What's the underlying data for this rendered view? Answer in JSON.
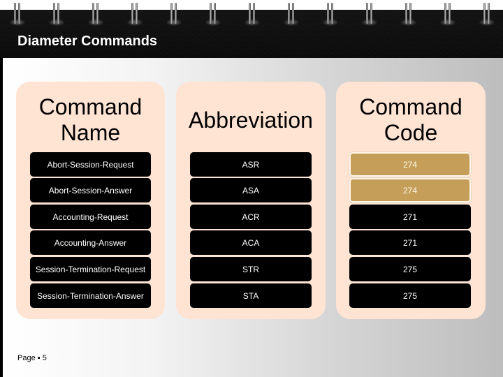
{
  "slide": {
    "title": "Diameter Commands",
    "footer": "Page ▪ 5"
  },
  "table": {
    "headers": {
      "name": "Command Name",
      "abbreviation": "Abbreviation",
      "code": "Command Code"
    },
    "rows": [
      {
        "name": "Abort-Session-Request",
        "abbreviation": "ASR",
        "code": "274",
        "highlight": true
      },
      {
        "name": "Abort-Session-Answer",
        "abbreviation": "ASA",
        "code": "274",
        "highlight": true
      },
      {
        "name": "Accounting-Request",
        "abbreviation": "ACR",
        "code": "271",
        "highlight": false
      },
      {
        "name": "Accounting-Answer",
        "abbreviation": "ACA",
        "code": "271",
        "highlight": false
      },
      {
        "name": "Session-Termination-Request",
        "abbreviation": "STR",
        "code": "275",
        "highlight": false
      },
      {
        "name": "Session-Termination-Answer",
        "abbreviation": "STA",
        "code": "275",
        "highlight": false
      }
    ]
  },
  "colors": {
    "panel": "#ffe4d4",
    "cell": "#000000",
    "highlight_cell": "#c59f5a"
  }
}
